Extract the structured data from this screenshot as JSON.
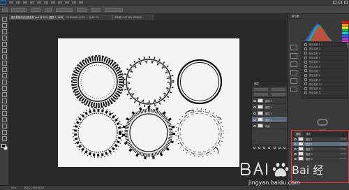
{
  "app": {
    "title": "Adobe Photoshop",
    "logo": "ps-logo"
  },
  "tabs": [
    {
      "label": "圆形藤蔓花纹边框素材.psd @ 50% (图层 1, RGB/8)"
    },
    {
      "label": "EFDB4A6B_0C83 ... @ 66.7%"
    },
    {
      "label": "未标题-1 @ 50% (RGB/8)"
    }
  ],
  "statusbar": {
    "zoom": "50%",
    "doc_info": "文档:2.25M/18.5M"
  },
  "right_dock": {
    "histogram_tab": "直方图",
    "properties_label": "属性面板",
    "presets": [
      "预设名称 1",
      "预设名称 2",
      "预设名称 3",
      "预设名称 4",
      "预设名称 5",
      "预设名称 6",
      "预设名称 7",
      "预设名称 8",
      "预设名称 9",
      "预设名称 10",
      "预设名称 11",
      "预设名称 12"
    ],
    "library_empty_text": "库面板",
    "colors": {
      "histogram": [
        "#ff2a2a",
        "#22d14a",
        "#2b5cff",
        "#ffffff"
      ],
      "swatches": [
        "#ff0000",
        "#ff9900",
        "#ffff00",
        "#00cc33",
        "#00ccff",
        "#3355ff",
        "#9933ff",
        "#ff33cc",
        "#ffffff",
        "#888888"
      ]
    }
  },
  "layers_float": {
    "title": "图层",
    "layers": [
      {
        "name": "图层 5",
        "selected": false
      },
      {
        "name": "图层 4",
        "selected": false
      },
      {
        "name": "图层 3",
        "selected": false
      },
      {
        "name": "图层 2",
        "selected": true
      },
      {
        "name": "背景",
        "selected": false
      }
    ]
  },
  "layers_highlighted": {
    "tab_active": "图层",
    "tab_other": "通道",
    "rows": [
      {
        "name": "图层 1",
        "size": "30.0K"
      },
      {
        "name": "图层 2",
        "size": "30.0K"
      },
      {
        "name": "图层 3",
        "size": "30.0K"
      },
      {
        "name": "图层 4",
        "size": "30.0K"
      },
      {
        "name": "图层 5",
        "size": "30.0K"
      }
    ],
    "accent": "#e33333"
  },
  "document": {
    "background": "#f4f4f4",
    "wreaths": [
      {
        "style": "lace-dense"
      },
      {
        "style": "vine-leaves"
      },
      {
        "style": "thin-double"
      },
      {
        "style": "jagged-lace"
      },
      {
        "style": "lace-scallop"
      },
      {
        "style": "vine-light"
      }
    ]
  },
  "watermark": {
    "brand": "Bai 经验",
    "url": "jingyan.baidu.com"
  }
}
